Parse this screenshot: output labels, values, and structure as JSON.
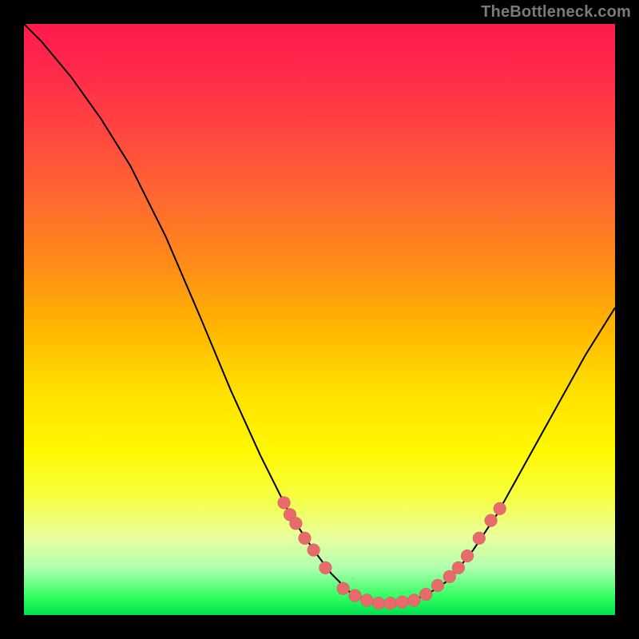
{
  "attribution": "TheBottleneck.com",
  "chart_data": {
    "type": "line",
    "title": "",
    "xlabel": "",
    "ylabel": "",
    "xlim": [
      0,
      100
    ],
    "ylim": [
      0,
      100
    ],
    "curve": [
      {
        "x": 0,
        "y": 100
      },
      {
        "x": 3,
        "y": 97
      },
      {
        "x": 8,
        "y": 91
      },
      {
        "x": 13,
        "y": 84
      },
      {
        "x": 18,
        "y": 76
      },
      {
        "x": 24,
        "y": 64
      },
      {
        "x": 30,
        "y": 50
      },
      {
        "x": 35,
        "y": 38
      },
      {
        "x": 40,
        "y": 27
      },
      {
        "x": 45,
        "y": 17
      },
      {
        "x": 49,
        "y": 11
      },
      {
        "x": 52,
        "y": 7
      },
      {
        "x": 55,
        "y": 4
      },
      {
        "x": 58,
        "y": 2.5
      },
      {
        "x": 60,
        "y": 2
      },
      {
        "x": 63,
        "y": 2
      },
      {
        "x": 66,
        "y": 2.5
      },
      {
        "x": 69,
        "y": 4
      },
      {
        "x": 72,
        "y": 6
      },
      {
        "x": 76,
        "y": 11
      },
      {
        "x": 80,
        "y": 17
      },
      {
        "x": 85,
        "y": 26
      },
      {
        "x": 90,
        "y": 35
      },
      {
        "x": 95,
        "y": 44
      },
      {
        "x": 100,
        "y": 52
      }
    ],
    "markers_left": [
      {
        "x": 44,
        "y": 19
      },
      {
        "x": 45,
        "y": 17
      },
      {
        "x": 46,
        "y": 15.5
      },
      {
        "x": 47.5,
        "y": 13
      },
      {
        "x": 49,
        "y": 11
      },
      {
        "x": 51,
        "y": 8
      }
    ],
    "markers_bottom": [
      {
        "x": 54,
        "y": 4.5
      },
      {
        "x": 56,
        "y": 3.3
      },
      {
        "x": 58,
        "y": 2.5
      },
      {
        "x": 60,
        "y": 2
      },
      {
        "x": 62,
        "y": 2
      },
      {
        "x": 64,
        "y": 2.2
      },
      {
        "x": 66,
        "y": 2.5
      },
      {
        "x": 68,
        "y": 3.5
      },
      {
        "x": 70,
        "y": 5
      }
    ],
    "markers_right": [
      {
        "x": 72,
        "y": 6.5
      },
      {
        "x": 73.5,
        "y": 8
      },
      {
        "x": 75,
        "y": 10
      },
      {
        "x": 77,
        "y": 13
      },
      {
        "x": 79,
        "y": 16
      },
      {
        "x": 80.5,
        "y": 18
      }
    ]
  }
}
